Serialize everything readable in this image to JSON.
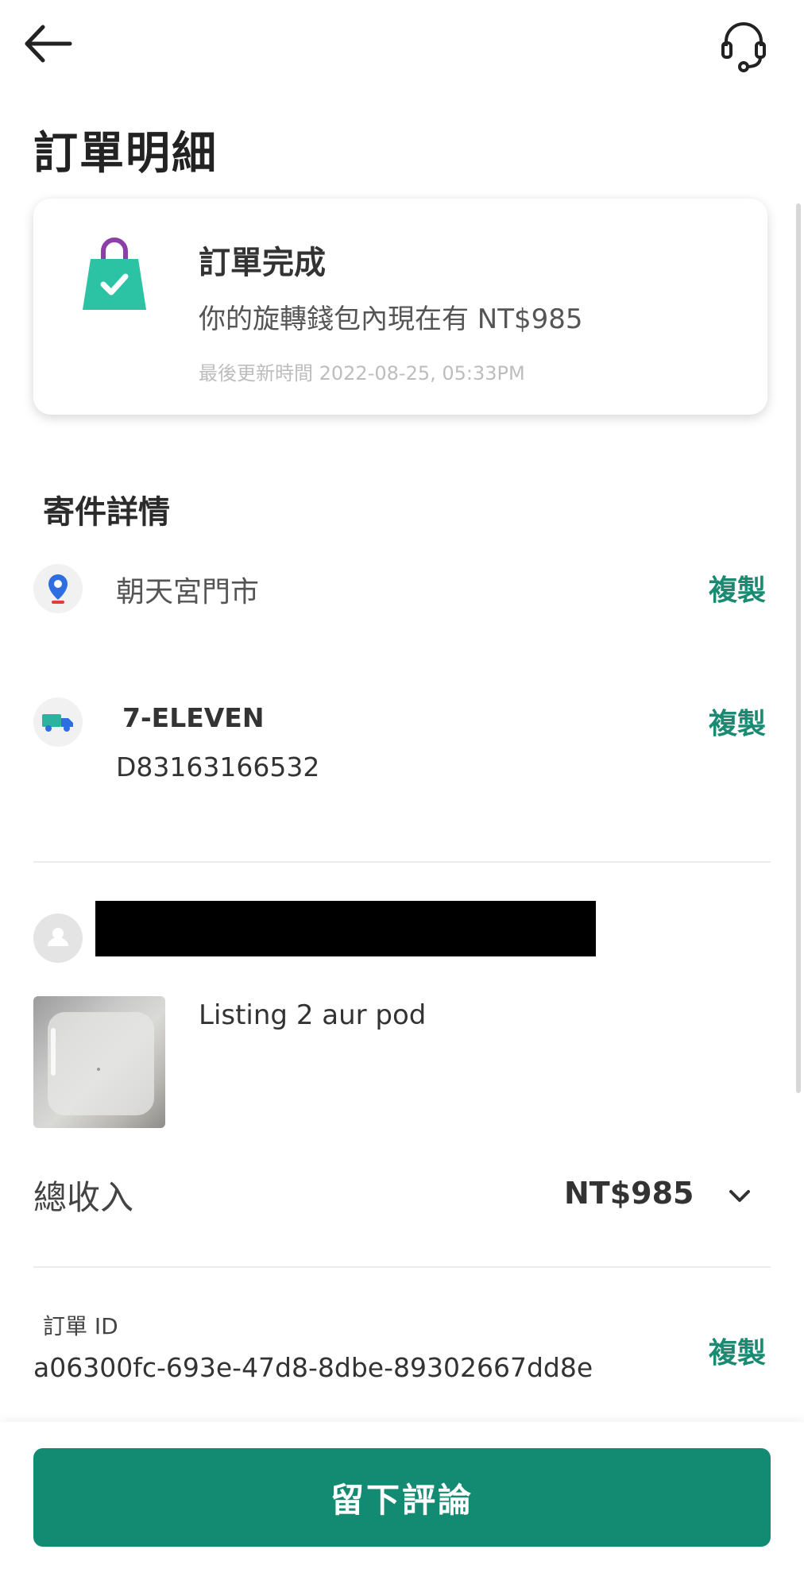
{
  "header": {
    "title": "訂單明細",
    "back_icon": "arrow-left-icon",
    "support_icon": "headset-icon"
  },
  "status_card": {
    "title": "訂單完成",
    "message": "你的旋轉錢包內現在有 NT$985",
    "updated": "最後更新時間 2022-08-25, 05:33PM",
    "icon": "shopping-bag-check-icon",
    "icon_color": "#2bc3a3",
    "handle_color": "#8d3fa8"
  },
  "shipping": {
    "section_title": "寄件詳情",
    "store": {
      "icon": "location-pin-icon",
      "name": "朝天宮門市",
      "copy_label": "複製"
    },
    "courier": {
      "icon": "delivery-truck-icon",
      "name": "7-ELEVEN",
      "tracking_number": "D83163166532",
      "copy_label": "複製"
    }
  },
  "buyer": {
    "avatar_icon": "user-avatar-icon"
  },
  "listing": {
    "title": "Listing 2 aur pod"
  },
  "total": {
    "label": "總收入",
    "amount": "NT$985",
    "expand_icon": "chevron-down-icon"
  },
  "order": {
    "id_label": "訂單 ID",
    "id_value": "a06300fc-693e-47d8-8dbe-89302667dd8e",
    "copy_label": "複製"
  },
  "footer": {
    "review_button_label": "留下評論"
  },
  "colors": {
    "accent": "#138a72",
    "link": "#1a8a72"
  }
}
